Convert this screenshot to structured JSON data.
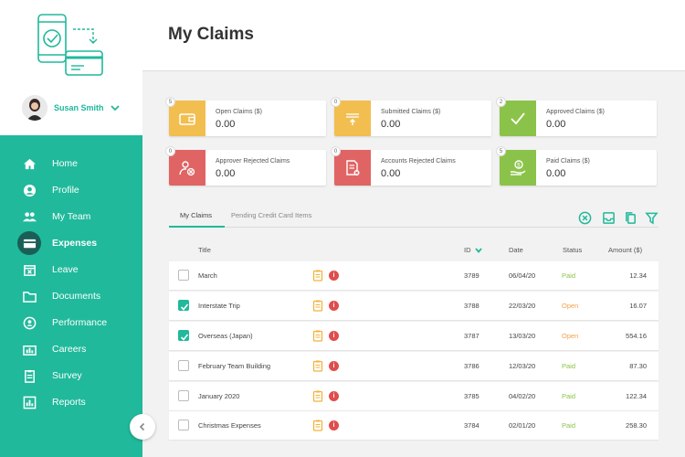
{
  "user": {
    "name": "Susan Smith"
  },
  "nav": [
    {
      "label": "Home",
      "icon": "home-icon"
    },
    {
      "label": "Profile",
      "icon": "profile-icon"
    },
    {
      "label": "My Team",
      "icon": "team-icon"
    },
    {
      "label": "Expenses",
      "icon": "expenses-icon",
      "active": true
    },
    {
      "label": "Leave",
      "icon": "leave-icon"
    },
    {
      "label": "Documents",
      "icon": "folder-icon"
    },
    {
      "label": "Performance",
      "icon": "performance-icon"
    },
    {
      "label": "Careers",
      "icon": "careers-icon"
    },
    {
      "label": "Survey",
      "icon": "survey-icon"
    },
    {
      "label": "Reports",
      "icon": "reports-icon"
    }
  ],
  "header": {
    "title": "My Claims"
  },
  "cards": [
    {
      "count": "5",
      "label": "Open Claims ($)",
      "value": "0.00",
      "color": "#f2be4f",
      "icon": "wallet-icon"
    },
    {
      "count": "0",
      "label": "Submitted Claims ($)",
      "value": "0.00",
      "color": "#f2be4f",
      "icon": "submit-icon"
    },
    {
      "count": "2",
      "label": "Approved Claims ($)",
      "value": "0.00",
      "color": "#8bc34a",
      "icon": "check-icon"
    },
    {
      "count": "0",
      "label": "Approver Rejected Claims",
      "value": "0.00",
      "color": "#e06464",
      "icon": "user-reject-icon"
    },
    {
      "count": "0",
      "label": "Accounts Rejected Claims",
      "value": "0.00",
      "color": "#e06464",
      "icon": "doc-reject-icon"
    },
    {
      "count": "5",
      "label": "Paid Claims ($)",
      "value": "0.00",
      "color": "#8bc34a",
      "icon": "paid-hand-icon"
    }
  ],
  "tabs": [
    {
      "label": "My Claims",
      "active": true
    },
    {
      "label": "Pending Credit Card Items"
    }
  ],
  "table": {
    "headers": {
      "title": "Title",
      "id": "ID",
      "date": "Date",
      "status": "Status",
      "amount": "Amount ($)"
    },
    "rows": [
      {
        "checked": false,
        "title": "March",
        "id": "3789",
        "date": "06/04/20",
        "status": "Paid",
        "amount": "12.34"
      },
      {
        "checked": true,
        "title": "Interstate Trip",
        "id": "3788",
        "date": "22/03/20",
        "status": "Open",
        "amount": "16.07"
      },
      {
        "checked": true,
        "title": "Overseas (Japan)",
        "id": "3787",
        "date": "13/03/20",
        "status": "Open",
        "amount": "554.16"
      },
      {
        "checked": false,
        "title": "February Team Building",
        "id": "3786",
        "date": "12/03/20",
        "status": "Paid",
        "amount": "87.30"
      },
      {
        "checked": false,
        "title": "January 2020",
        "id": "3785",
        "date": "04/02/20",
        "status": "Paid",
        "amount": "122.34"
      },
      {
        "checked": false,
        "title": "Christmas Expenses",
        "id": "3784",
        "date": "02/01/20",
        "status": "Paid",
        "amount": "258.30"
      }
    ]
  },
  "colors": {
    "accent": "#20b99b",
    "paid": "#8bc34a",
    "open": "#f2a14a"
  }
}
